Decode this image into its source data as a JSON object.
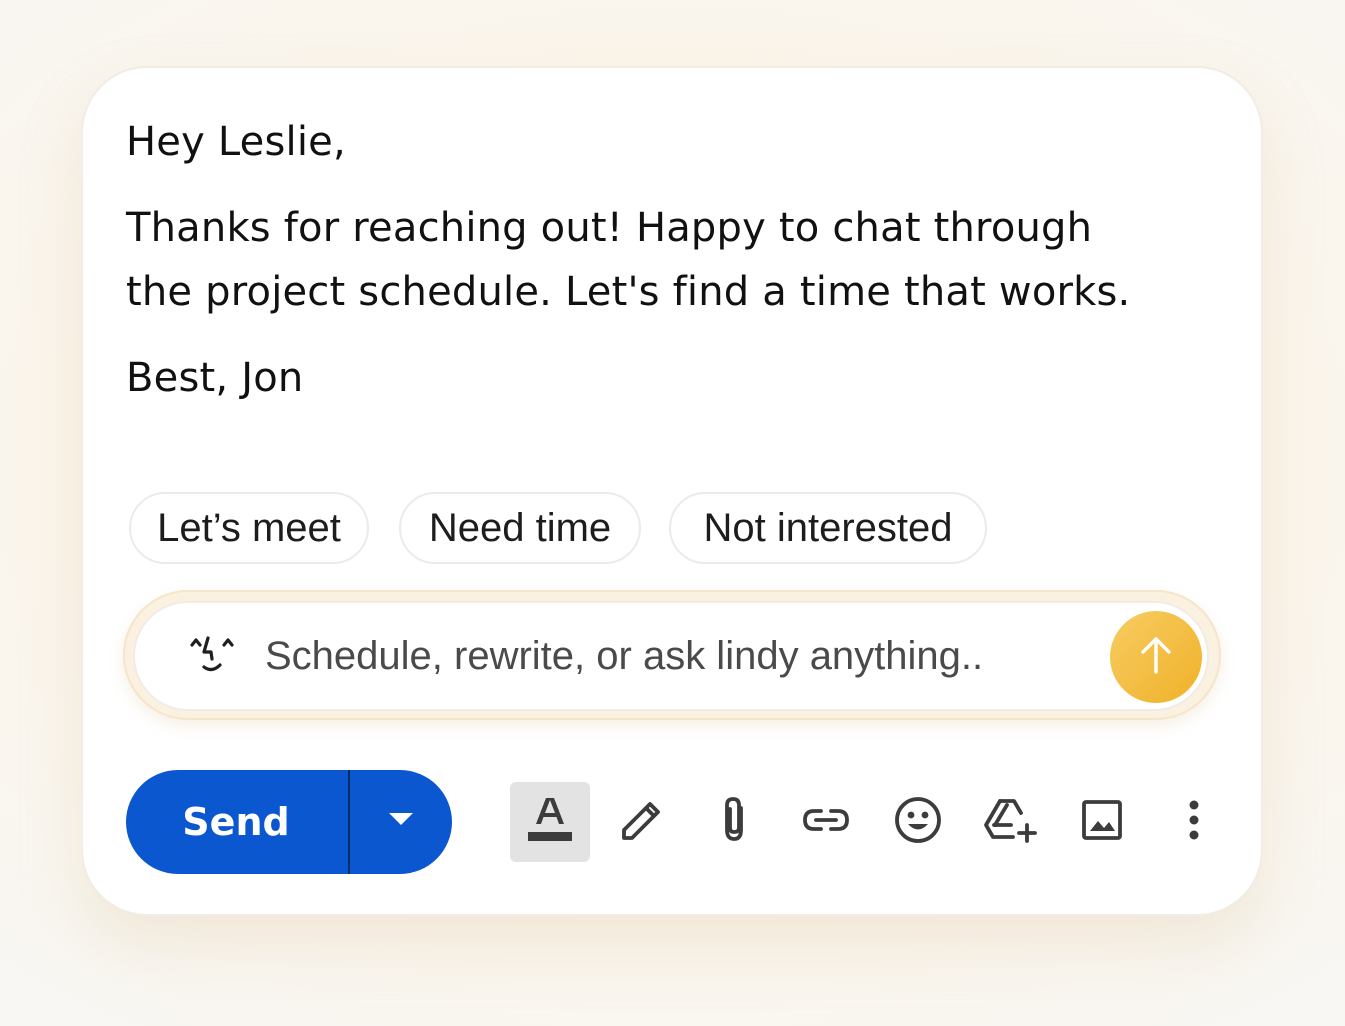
{
  "email": {
    "greeting": "Hey Leslie,",
    "body_line_1": "Thanks for reaching out! Happy to chat through",
    "body_line_2": "the project schedule. Let's find a time that works.",
    "signoff": "Best, Jon"
  },
  "suggestions": [
    {
      "label": "Let’s meet"
    },
    {
      "label": "Need time"
    },
    {
      "label": "Not interested"
    }
  ],
  "assistant": {
    "icon": "lindy-face-icon",
    "placeholder": "Schedule, rewrite, or ask lindy anything..",
    "value": "",
    "submit_icon": "arrow-up-icon",
    "accent_color": "#f0b128"
  },
  "compose_toolbar": {
    "send_label": "Send",
    "send_color": "#0b57d0",
    "send_options_icon": "caret-down-icon",
    "tools": [
      {
        "icon": "text-format-icon",
        "selected": true
      },
      {
        "icon": "pen-icon"
      },
      {
        "icon": "paperclip-icon"
      },
      {
        "icon": "link-icon"
      },
      {
        "icon": "emoji-icon"
      },
      {
        "icon": "drive-add-icon"
      },
      {
        "icon": "photo-icon"
      },
      {
        "icon": "more-vert-icon"
      }
    ]
  }
}
